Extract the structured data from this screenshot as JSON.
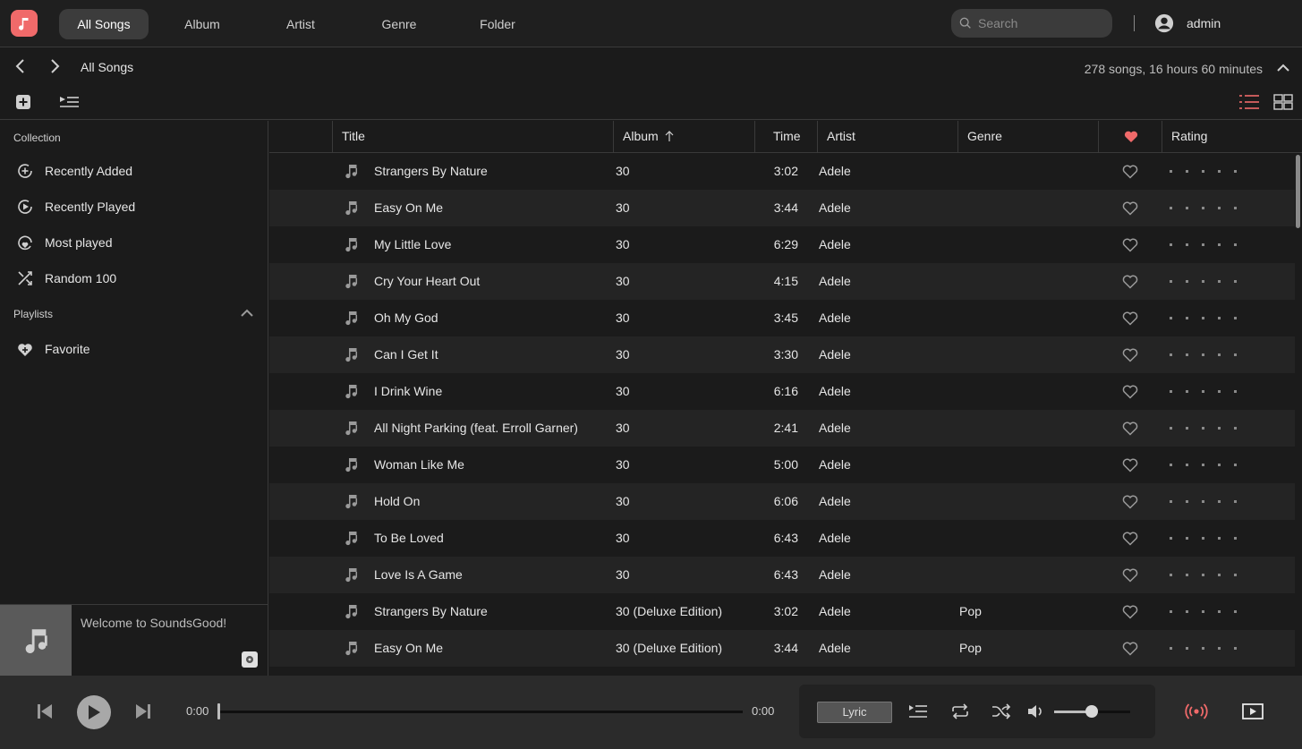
{
  "nav": {
    "tabs": [
      "All Songs",
      "Album",
      "Artist",
      "Genre",
      "Folder"
    ],
    "search_placeholder": "Search",
    "username": "admin"
  },
  "breadcrumb": {
    "title": "All Songs",
    "summary": "278 songs, 16 hours 60 minutes"
  },
  "sidebar": {
    "collection_label": "Collection",
    "collection": [
      "Recently Added",
      "Recently Played",
      "Most played",
      "Random 100"
    ],
    "playlists_label": "Playlists",
    "playlists": [
      "Favorite"
    ]
  },
  "mini": {
    "welcome": "Welcome to SoundsGood!"
  },
  "table": {
    "headers": {
      "title": "Title",
      "album": "Album",
      "time": "Time",
      "artist": "Artist",
      "genre": "Genre",
      "rating": "Rating"
    },
    "sort_icon": "arrow-up",
    "rows": [
      {
        "title": "Strangers By Nature",
        "album": "30",
        "time": "3:02",
        "artist": "Adele",
        "genre": ""
      },
      {
        "title": "Easy On Me",
        "album": "30",
        "time": "3:44",
        "artist": "Adele",
        "genre": ""
      },
      {
        "title": "My Little Love",
        "album": "30",
        "time": "6:29",
        "artist": "Adele",
        "genre": ""
      },
      {
        "title": "Cry Your Heart Out",
        "album": "30",
        "time": "4:15",
        "artist": "Adele",
        "genre": ""
      },
      {
        "title": "Oh My God",
        "album": "30",
        "time": "3:45",
        "artist": "Adele",
        "genre": ""
      },
      {
        "title": "Can I Get It",
        "album": "30",
        "time": "3:30",
        "artist": "Adele",
        "genre": ""
      },
      {
        "title": "I Drink Wine",
        "album": "30",
        "time": "6:16",
        "artist": "Adele",
        "genre": ""
      },
      {
        "title": "All Night Parking (feat. Erroll Garner)",
        "album": "30",
        "time": "2:41",
        "artist": "Adele",
        "genre": ""
      },
      {
        "title": "Woman Like Me",
        "album": "30",
        "time": "5:00",
        "artist": "Adele",
        "genre": ""
      },
      {
        "title": "Hold On",
        "album": "30",
        "time": "6:06",
        "artist": "Adele",
        "genre": ""
      },
      {
        "title": "To Be Loved",
        "album": "30",
        "time": "6:43",
        "artist": "Adele",
        "genre": ""
      },
      {
        "title": "Love Is A Game",
        "album": "30",
        "time": "6:43",
        "artist": "Adele",
        "genre": ""
      },
      {
        "title": "Strangers By Nature",
        "album": "30 (Deluxe Edition)",
        "time": "3:02",
        "artist": "Adele",
        "genre": "Pop"
      },
      {
        "title": "Easy On Me",
        "album": "30 (Deluxe Edition)",
        "time": "3:44",
        "artist": "Adele",
        "genre": "Pop"
      }
    ]
  },
  "player": {
    "current_time": "0:00",
    "total_time": "0:00",
    "lyric_label": "Lyric",
    "volume": 0.5
  },
  "colors": {
    "accent": "#f06a6a",
    "background": "#1b1b1b",
    "alt_row": "#242424",
    "player": "#2b2b2b"
  }
}
